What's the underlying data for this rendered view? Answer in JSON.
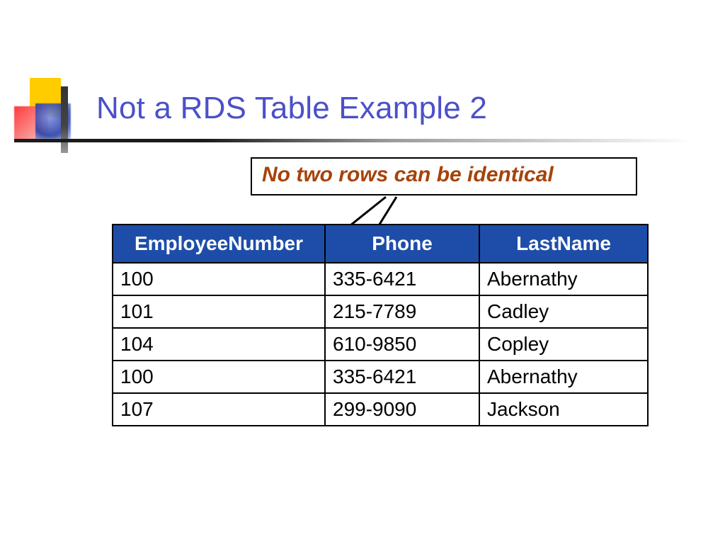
{
  "title": "Not a RDS Table Example 2",
  "callout": "No two rows can be identical",
  "table": {
    "headers": [
      "EmployeeNumber",
      "Phone",
      "LastName"
    ],
    "rows": [
      {
        "emp": "100",
        "phone": "335-6421",
        "last": "Abernathy"
      },
      {
        "emp": "101",
        "phone": "215-7789",
        "last": "Cadley"
      },
      {
        "emp": "104",
        "phone": "610-9850",
        "last": "Copley"
      },
      {
        "emp": "100",
        "phone": "335-6421",
        "last": "Abernathy"
      },
      {
        "emp": "107",
        "phone": "299-9090",
        "last": "Jackson"
      }
    ]
  }
}
